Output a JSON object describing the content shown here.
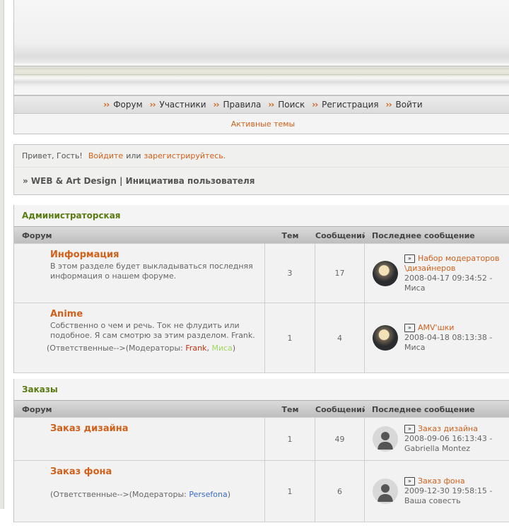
{
  "nav": {
    "items": [
      "Форум",
      "Участники",
      "Правила",
      "Поиск",
      "Регистрация",
      "Войти"
    ],
    "sub_link": "Активные темы"
  },
  "greeting": {
    "hello": "Привет, Гость!",
    "login": "Войдите",
    "or": "или",
    "register": "зарегистрируйтесь."
  },
  "breadcrumb": "» WEB & Art Design | Инициатива пользователя",
  "columns": {
    "forum": "Форум",
    "topics": "Тем",
    "posts": "Сообщений",
    "last": "Последнее сообщение"
  },
  "categories": [
    {
      "title": "Администраторская",
      "forums": [
        {
          "name": "Информация",
          "desc": "В этом разделе будет выкладываться последняя информация о нашем форуме.",
          "topics": "3",
          "posts": "17",
          "last_title": "Набор модераторов \\дизайнеров",
          "last_meta": "2008-04-17 09:34:52 - Миса",
          "avatar": "photo"
        },
        {
          "name": "Anime",
          "desc": "Собственно о чем и речь. Ток не флудить или подобное. Я сам смотрю за этим разделом. Frank.",
          "mods_prefix": "(Ответственные-->(Модераторы: ",
          "mods": [
            "Frank",
            "Миса"
          ],
          "mods_suffix": ")",
          "topics": "1",
          "posts": "4",
          "last_title": "AMV'шки",
          "last_meta": "2008-04-18 08:13:38 - Миса",
          "avatar": "photo"
        }
      ]
    },
    {
      "title": "Заказы",
      "forums": [
        {
          "name": "Заказ дизайна",
          "topics": "1",
          "posts": "49",
          "last_title": "Заказ дизайна",
          "last_meta": "2008-09-06 16:13:43 - Gabriella Montez",
          "avatar": "blank"
        },
        {
          "name": "Заказ фона",
          "mods_prefix": "(Ответственные-->(Модераторы: ",
          "mods": [
            "Persefona"
          ],
          "mods_suffix": ")",
          "topics": "1",
          "posts": "6",
          "last_title": "Заказ фона",
          "last_meta": "2009-12-30 19:58:15 - Ваша совесть",
          "avatar": "blank"
        }
      ]
    }
  ],
  "colors": {
    "accent": "#d0601a",
    "category": "#5a7a12"
  }
}
